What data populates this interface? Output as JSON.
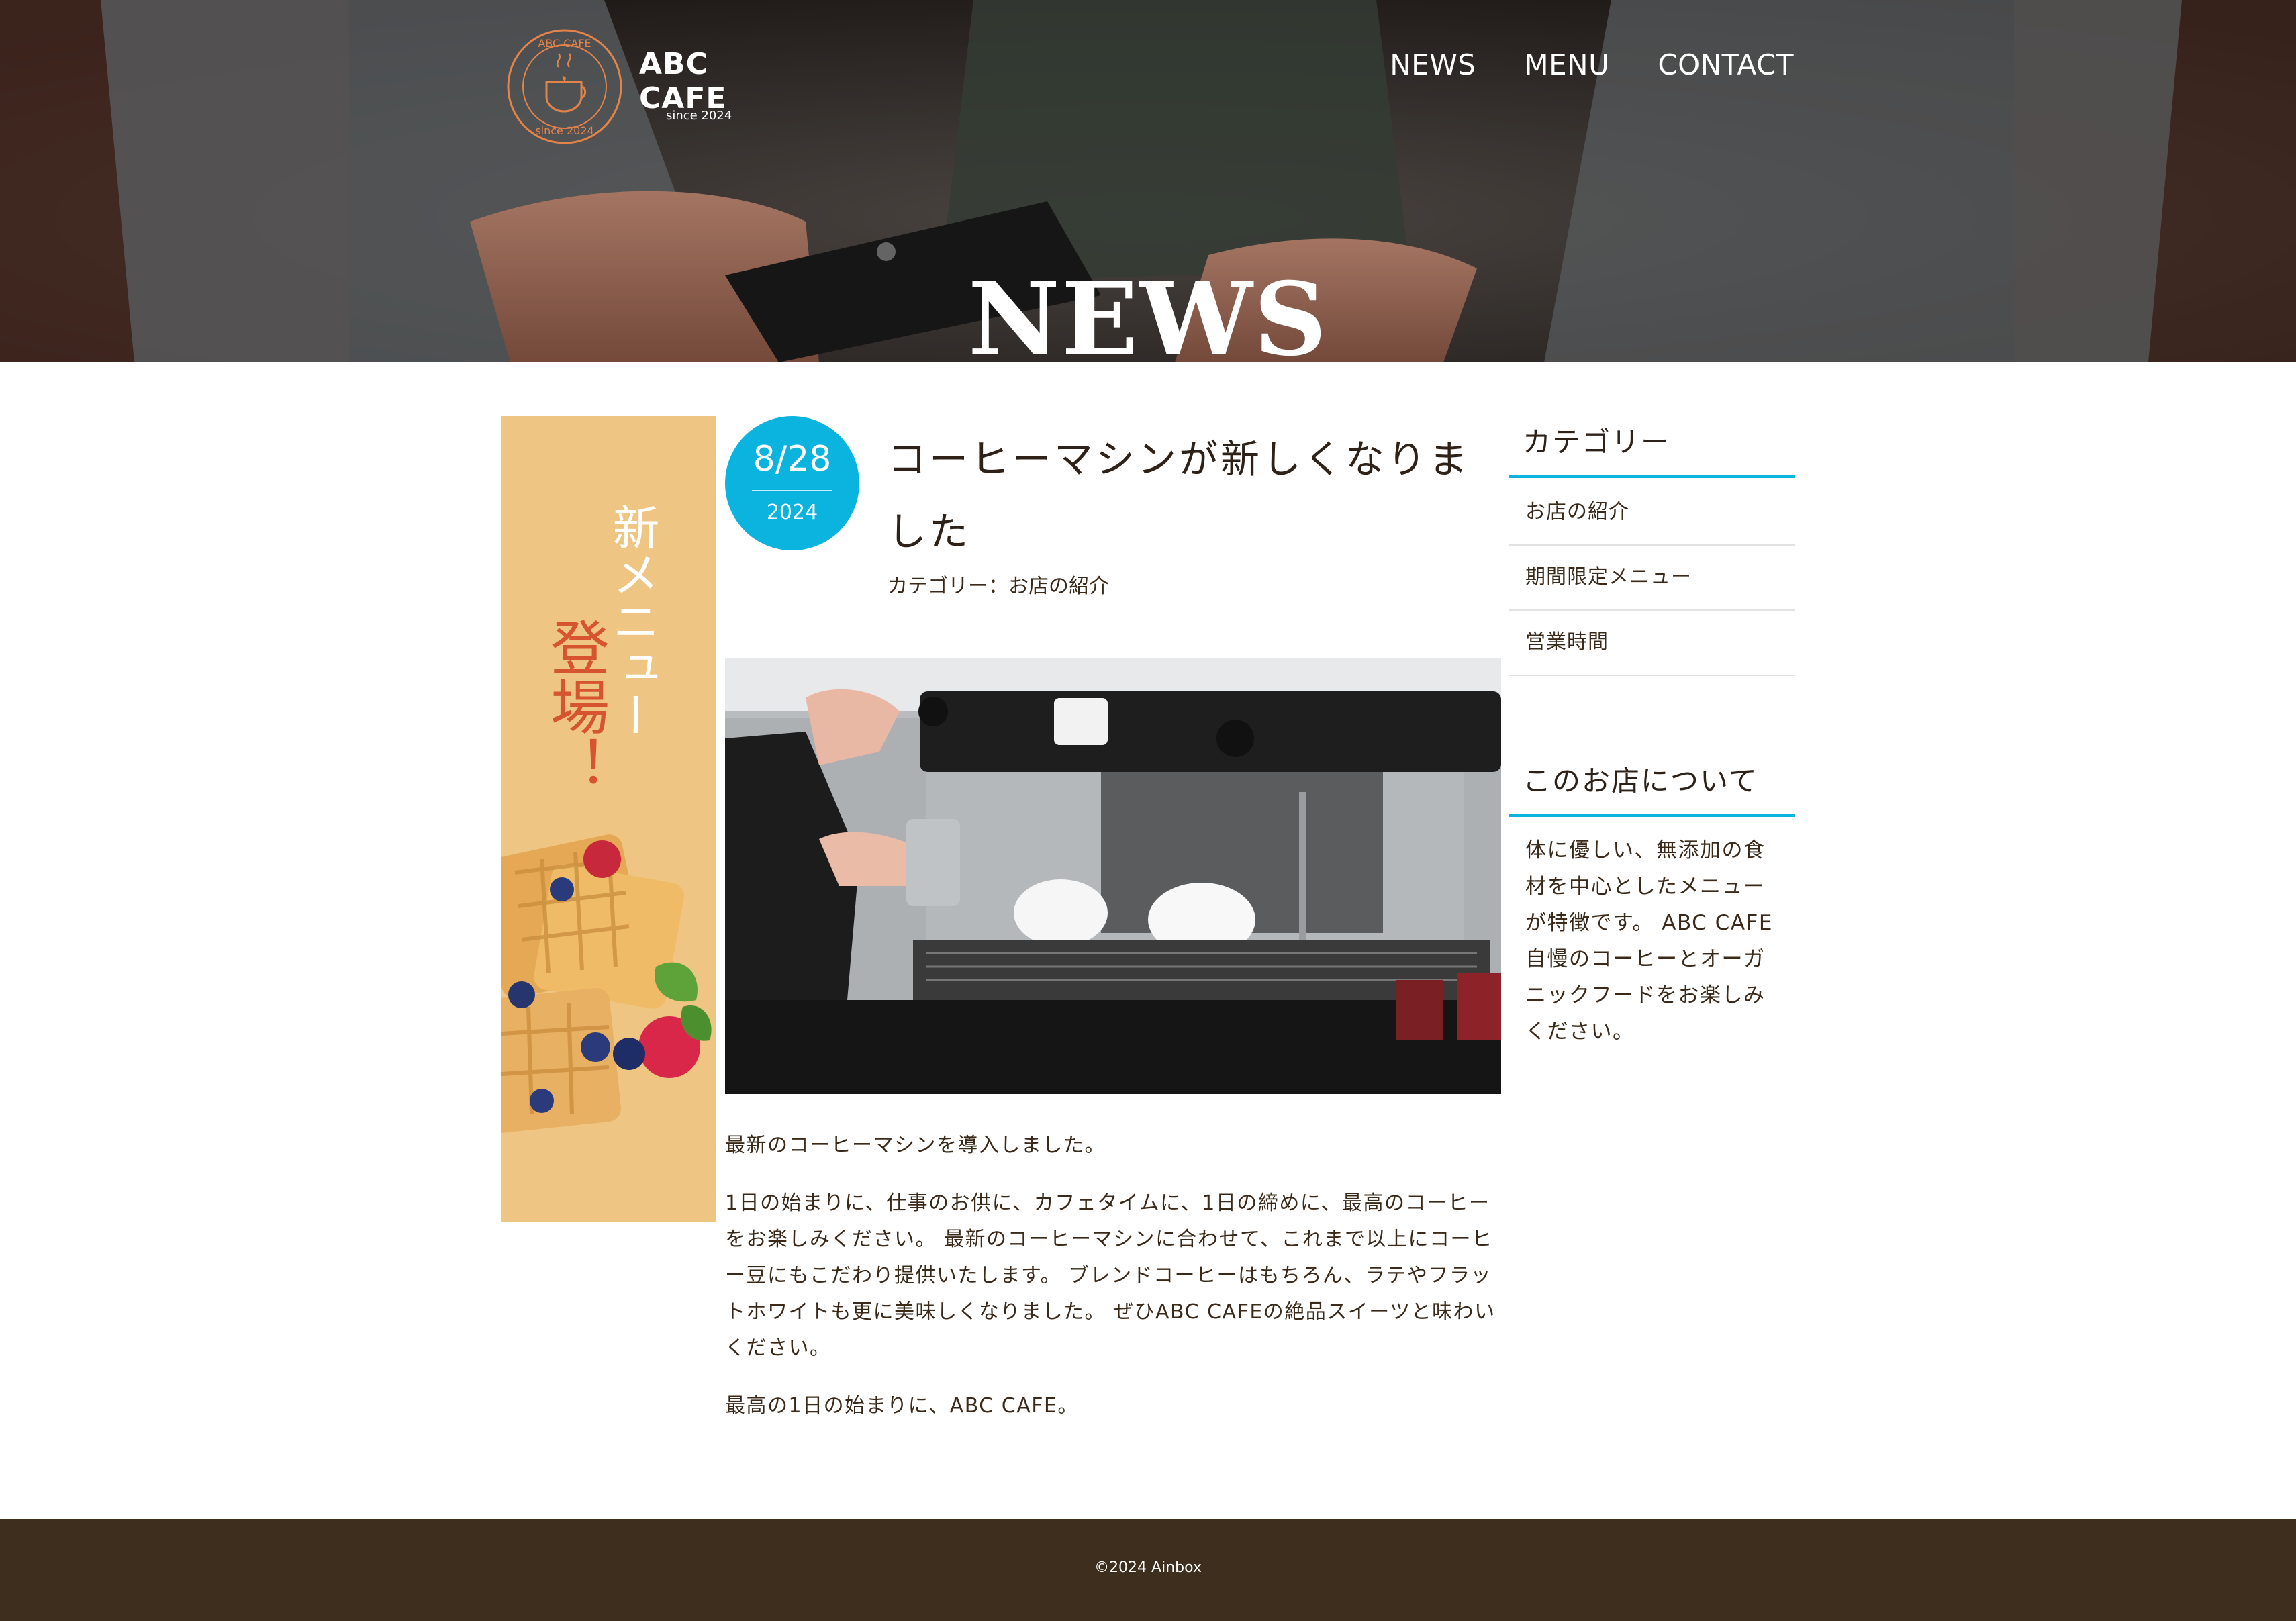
{
  "brand": {
    "name": "ABC CAFE",
    "tagline": "since 2024",
    "badge_top": "ABC CAFE",
    "badge_bottom": "since 2024"
  },
  "nav": {
    "items": [
      {
        "label": "NEWS"
      },
      {
        "label": "MENU"
      },
      {
        "label": "CONTACT"
      }
    ]
  },
  "hero": {
    "title": "NEWS"
  },
  "banner": {
    "line1": "新メニュー",
    "line2": "登場！"
  },
  "article": {
    "date_md": "8/28",
    "date_year": "2024",
    "title": "コーヒーマシンが新しくなりました",
    "category": "カテゴリー：お店の紹介",
    "paragraphs": [
      "最新のコーヒーマシンを導入しました。",
      "1日の始まりに、仕事のお供に、カフェタイムに、1日の締めに、最高のコーヒーをお楽しみください。 最新のコーヒーマシンに合わせて、これまで以上にコーヒー豆にもこだわり提供いたします。 ブレンドコーヒーはもちろん、ラテやフラットホワイトも更に美味しくなりました。 ぜひABC CAFEの絶品スイーツと味わいください。",
      "最高の1日の始まりに、ABC CAFE。"
    ]
  },
  "sidebar": {
    "categories_heading": "カテゴリー",
    "categories": [
      {
        "label": "お店の紹介"
      },
      {
        "label": "期間限定メニュー"
      },
      {
        "label": "営業時間"
      }
    ],
    "about_heading": "このお店について",
    "about_text": "体に優しい、無添加の食材を中心としたメニューが特徴です。 ABC CAFE自慢のコーヒーとオーガニックフードをお楽しみください。"
  },
  "footer": {
    "copyright": "©2024 Ainbox"
  },
  "colors": {
    "accent": "#0bb3df",
    "footer_bg": "#3d2e1e",
    "banner_bg": "#efc584",
    "text": "#3b2a1a"
  }
}
